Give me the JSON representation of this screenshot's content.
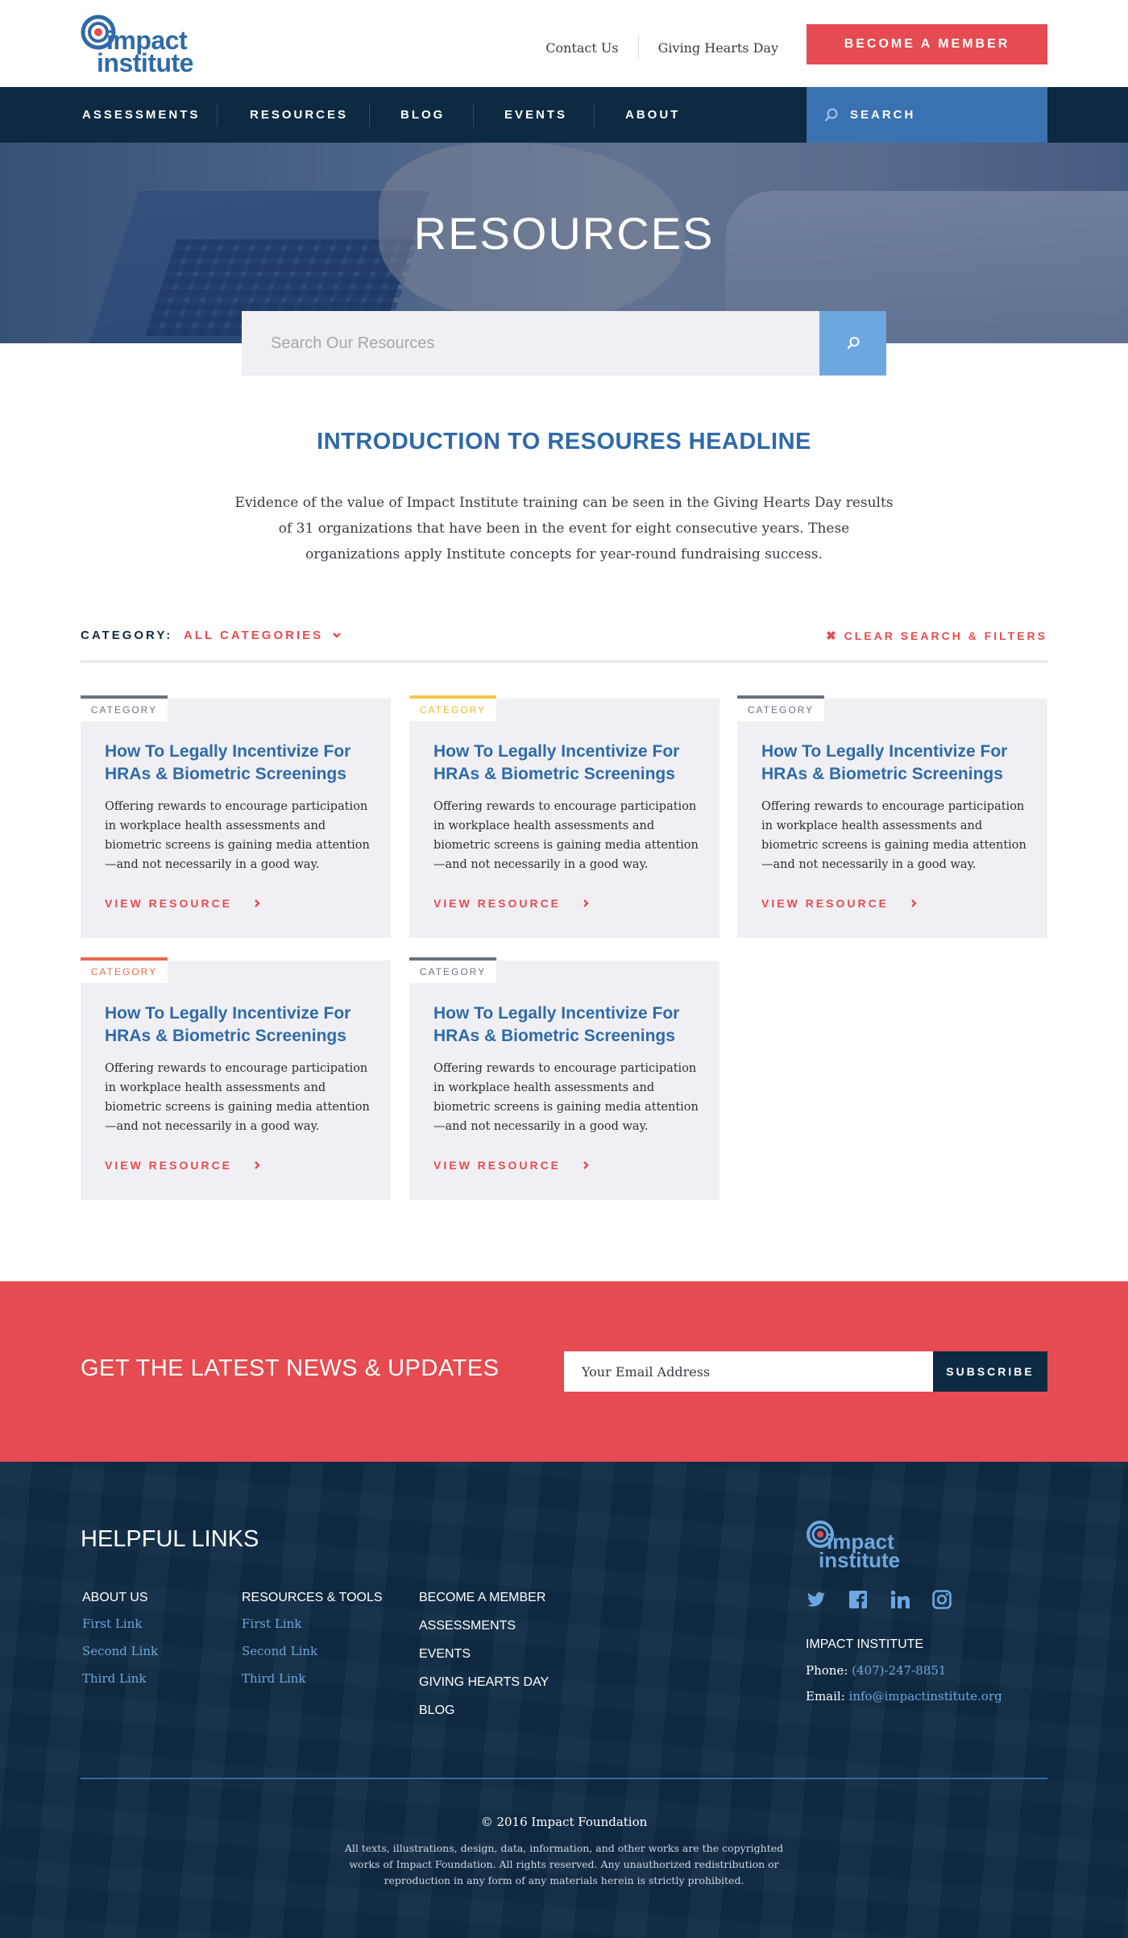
{
  "header": {
    "logo_line1": "impact",
    "logo_line2": "institute",
    "links": [
      "Contact Us",
      "Giving Hearts Day"
    ],
    "member_button": "BECOME A MEMBER"
  },
  "nav": {
    "items": [
      "ASSESSMENTS",
      "RESOURCES",
      "BLOG",
      "EVENTS",
      "ABOUT"
    ],
    "search_label": "SEARCH"
  },
  "hero": {
    "title": "RESOURCES",
    "search_placeholder": "Search Our Resources"
  },
  "intro": {
    "title": "INTRODUCTION TO RESOURES HEADLINE",
    "text": "Evidence of the value of Impact Institute training can be seen in the Giving Hearts Day results of 31 organizations that have been in the event for eight consecutive years. These organizations apply Institute concepts for year-round fundraising success."
  },
  "filter": {
    "label": "CATEGORY:",
    "selected": "ALL CATEGORIES",
    "clear": "CLEAR SEARCH & FILTERS"
  },
  "cards": [
    {
      "tag": "CATEGORY",
      "tag_color": "#6b7280",
      "title": "How To Legally Incentivize For HRAs & Biometric Screenings",
      "text": "Offering rewards to encourage participation in workplace health assessments and biometric screens is gaining media attention—and not necessarily in a good way.",
      "link": "VIEW RESOURCE"
    },
    {
      "tag": "CATEGORY",
      "tag_color": "#f2c94c",
      "title": "How To Legally Incentivize For HRAs & Biometric Screenings",
      "text": "Offering rewards to encourage participation in workplace health assessments and biometric screens is gaining media attention—and not necessarily in a good way.",
      "link": "VIEW RESOURCE"
    },
    {
      "tag": "CATEGORY",
      "tag_color": "#6b7280",
      "title": "How To Legally Incentivize For HRAs & Biometric Screenings",
      "text": "Offering rewards to encourage participation in workplace health assessments and biometric screens is gaining media attention—and not necessarily in a good way.",
      "link": "VIEW RESOURCE"
    },
    {
      "tag": "CATEGORY",
      "tag_color": "#e8684f",
      "title": "How To Legally Incentivize For HRAs & Biometric Screenings",
      "text": "Offering rewards to encourage participation in workplace health assessments and biometric screens is gaining media attention—and not necessarily in a good way.",
      "link": "VIEW RESOURCE"
    },
    {
      "tag": "CATEGORY",
      "tag_color": "#6b7280",
      "title": "How To Legally Incentivize For HRAs & Biometric Screenings",
      "text": "Offering rewards to encourage participation in workplace health assessments and biometric screens is gaining media attention—and not necessarily in a good way.",
      "link": "VIEW RESOURCE"
    }
  ],
  "newsletter": {
    "title": "GET THE LATEST NEWS & UPDATES",
    "placeholder": "Your Email Address",
    "button": "SUBSCRIBE"
  },
  "footer": {
    "title": "HELPFUL LINKS",
    "col1": {
      "head": "ABOUT US",
      "links": [
        "First Link",
        "Second Link",
        "Third Link"
      ]
    },
    "col2": {
      "head": "RESOURCES & TOOLS",
      "links": [
        "First Link",
        "Second Link",
        "Third Link"
      ]
    },
    "col3": {
      "links": [
        "BECOME A MEMBER",
        "ASSESSMENTS",
        "EVENTS",
        "GIVING HEARTS DAY",
        "BLOG"
      ]
    },
    "logo_line1": "impact",
    "logo_line2": "institute",
    "social_icons": [
      "twitter-icon",
      "facebook-icon",
      "linkedin-icon",
      "instagram-icon"
    ],
    "org_name": "IMPACT INSTITUTE",
    "phone_label": "Phone:",
    "phone": "(407)-247-8851",
    "email_label": "Email:",
    "email": "info@impactinstitute.org",
    "copyright": "© 2016 Impact Foundation",
    "legal": "All texts, illustrations, design, data, information, and other works are the copyrighted works of Impact Foundation. All rights reserved. Any unauthorized redistribution or reproduction in any form of any materials herein is strictly prohibited."
  },
  "colors": {
    "brand_red": "#e54b50",
    "brand_navy": "#0e2a42",
    "brand_blue": "#2f6aa8",
    "light_blue": "#6da7df"
  }
}
